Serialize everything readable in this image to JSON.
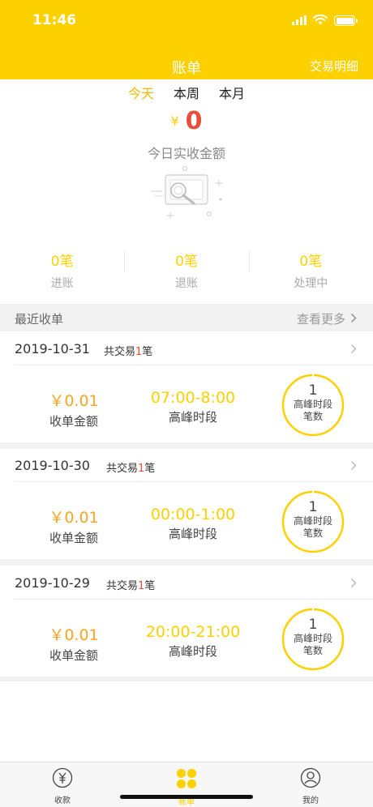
{
  "status_bar": {
    "time": "11:46"
  },
  "nav": {
    "title": "账单",
    "right_action": "交易明细"
  },
  "period_tabs": [
    {
      "label": "今天",
      "active": true
    },
    {
      "label": "本周",
      "active": false
    },
    {
      "label": "本月",
      "active": false
    }
  ],
  "summary": {
    "currency": "¥",
    "amount": "0",
    "caption": "今日实收金额"
  },
  "stats": [
    {
      "value": "0笔",
      "label": "进账"
    },
    {
      "value": "0笔",
      "label": "退账"
    },
    {
      "value": "0笔",
      "label": "处理中"
    }
  ],
  "recent": {
    "title": "最近收单",
    "more_label": "查看更多",
    "records": [
      {
        "date": "2019-10-31",
        "count_prefix": "共交易",
        "count": "1",
        "count_suffix": "笔",
        "amount": "￥0.01",
        "amount_label": "收单金额",
        "peak_time": "07:00-8:00",
        "peak_label": "高峰时段",
        "ring_value": "1",
        "ring_line1": "高峰时段",
        "ring_line2": "笔数"
      },
      {
        "date": "2019-10-30",
        "count_prefix": "共交易",
        "count": "1",
        "count_suffix": "笔",
        "amount": "￥0.01",
        "amount_label": "收单金额",
        "peak_time": "00:00-1:00",
        "peak_label": "高峰时段",
        "ring_value": "1",
        "ring_line1": "高峰时段",
        "ring_line2": "笔数"
      },
      {
        "date": "2019-10-29",
        "count_prefix": "共交易",
        "count": "1",
        "count_suffix": "笔",
        "amount": "￥0.01",
        "amount_label": "收单金额",
        "peak_time": "20:00-21:00",
        "peak_label": "高峰时段",
        "ring_value": "1",
        "ring_line1": "高峰时段",
        "ring_line2": "笔数"
      }
    ]
  },
  "tabbar": [
    {
      "label": "收款",
      "icon": "yuan-circle-icon",
      "active": false
    },
    {
      "label": "账单",
      "icon": "grid-icon",
      "active": true
    },
    {
      "label": "我的",
      "icon": "user-icon",
      "active": false
    }
  ],
  "colors": {
    "brand_yellow": "#FDD000",
    "amount_orange": "#F5A623",
    "accent_red": "#E84D3D"
  }
}
